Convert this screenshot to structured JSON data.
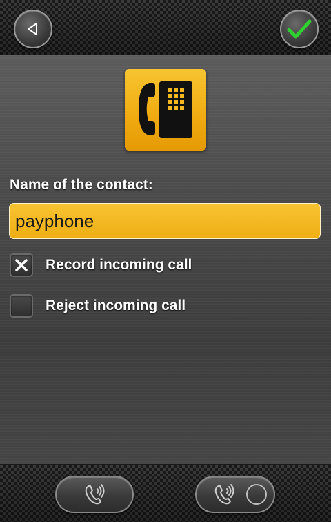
{
  "header": {
    "back_icon": "back-triangle-icon",
    "confirm_icon": "checkmark-icon",
    "accent_color": "#2fd12f"
  },
  "contact_icon": "payphone-icon",
  "form": {
    "name_label": "Name of the contact:",
    "name_value": "payphone",
    "record_label": "Record incoming call",
    "record_checked": true,
    "reject_label": "Reject incoming call",
    "reject_checked": false,
    "field_color": "#f0ad13"
  },
  "footer": {
    "left_icon": "call-sound-icon",
    "right_icon": "call-sound-icon",
    "right_toggle_on": false
  }
}
